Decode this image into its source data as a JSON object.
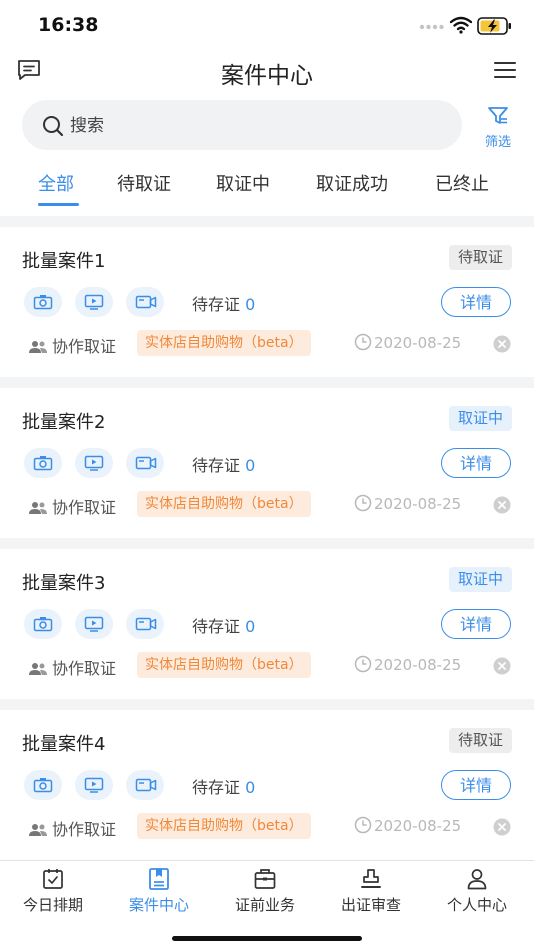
{
  "status": {
    "time": "16:38"
  },
  "header": {
    "title": "案件中心"
  },
  "search": {
    "placeholder": "搜索",
    "filter_label": "筛选"
  },
  "tabs": [
    {
      "label": "全部",
      "active": true
    },
    {
      "label": "待取证"
    },
    {
      "label": "取证中"
    },
    {
      "label": "取证成功"
    },
    {
      "label": "已终止"
    }
  ],
  "cards": [
    {
      "title": "批量案件1",
      "status": "待取证",
      "pending_label": "待存证",
      "pending_count": "0",
      "detail_label": "详情",
      "collab_label": "协作取证",
      "tag": "实体店自助购物（beta）",
      "date": "2020-08-25"
    },
    {
      "title": "批量案件2",
      "status": "取证中",
      "pending_label": "待存证",
      "pending_count": "0",
      "detail_label": "详情",
      "collab_label": "协作取证",
      "tag": "实体店自助购物（beta）",
      "date": "2020-08-25"
    },
    {
      "title": "批量案件3",
      "status": "取证中",
      "pending_label": "待存证",
      "pending_count": "0",
      "detail_label": "详情",
      "collab_label": "协作取证",
      "tag": "实体店自助购物（beta）",
      "date": "2020-08-25"
    },
    {
      "title": "批量案件4",
      "status": "待取证",
      "pending_label": "待存证",
      "pending_count": "0",
      "detail_label": "详情",
      "collab_label": "协作取证",
      "tag": "实体店自助购物（beta）",
      "date": "2020-08-25"
    }
  ],
  "bottom_nav": [
    {
      "label": "今日排期",
      "icon": "calendar-icon"
    },
    {
      "label": "案件中心",
      "icon": "bookmark-doc-icon",
      "active": true
    },
    {
      "label": "证前业务",
      "icon": "briefcase-icon"
    },
    {
      "label": "出证审查",
      "icon": "stamp-icon"
    },
    {
      "label": "个人中心",
      "icon": "user-icon"
    }
  ],
  "colors": {
    "accent": "#3b8ee8",
    "tag_text": "#f0883a",
    "tag_bg": "#fdecde"
  }
}
